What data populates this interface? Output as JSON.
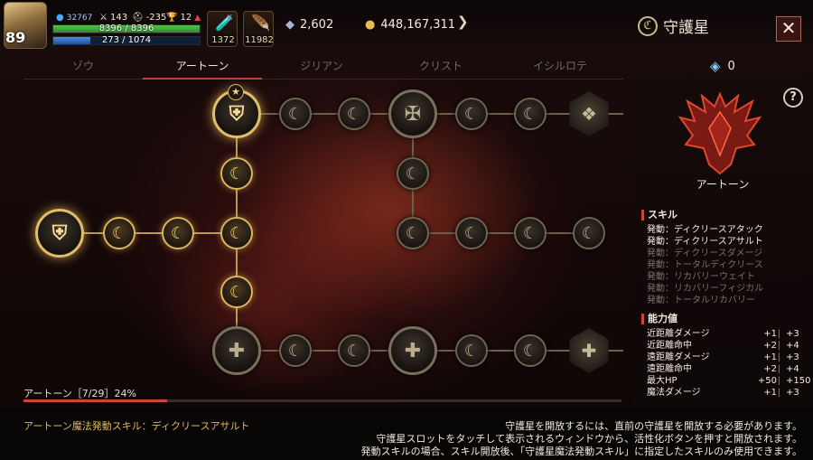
{
  "player": {
    "level": "89",
    "power": "32767",
    "attack": "143",
    "defense": "-235",
    "trophy": "12",
    "hp_text": "8396 / 8396",
    "mp_text": "273 / 1074",
    "mp_fraction": 0.254
  },
  "items": [
    {
      "icon": "potion-bag-icon",
      "glyph": "🧪",
      "count": "1372"
    },
    {
      "icon": "feather-potion-icon",
      "glyph": "🪶",
      "count": "11982"
    }
  ],
  "currency": {
    "crystal": "2,602",
    "gold": "448,167,311"
  },
  "header": {
    "title": "守護星",
    "close_label": "✕"
  },
  "tabs": [
    {
      "label": "ゾウ",
      "active": false
    },
    {
      "label": "アートーン",
      "active": true
    },
    {
      "label": "ジリアン",
      "active": false
    },
    {
      "label": "クリスト",
      "active": false
    },
    {
      "label": "イシルロテ",
      "active": false
    }
  ],
  "gem_count": "0",
  "tree": {
    "selected_badge": "★",
    "progress_text": "アートーン［7/29］24%",
    "progress_fraction": 0.24
  },
  "panel": {
    "help_label": "?",
    "emblem_label": "アートーン",
    "skill_title": "スキル",
    "skills": [
      {
        "text": "発動：ディクリースアタック",
        "active": true
      },
      {
        "text": "発動：ディクリースアサルト",
        "active": true
      },
      {
        "text": "発動：ディクリースダメージ",
        "active": false
      },
      {
        "text": "発動：トータルディクリース",
        "active": false
      },
      {
        "text": "発動：リカバリーウェイト",
        "active": false
      },
      {
        "text": "発動：リカバリーフィジカル",
        "active": false
      },
      {
        "text": "発動：トータルリカバリー",
        "active": false
      }
    ],
    "stat_title": "能力値",
    "stats": [
      {
        "name": "近距離ダメージ",
        "current": "+1",
        "max": "+3"
      },
      {
        "name": "近距離命中",
        "current": "+2",
        "max": "+4"
      },
      {
        "name": "遠距離ダメージ",
        "current": "+1",
        "max": "+3"
      },
      {
        "name": "遠距離命中",
        "current": "+2",
        "max": "+4"
      },
      {
        "name": "最大HP",
        "current": "+50",
        "max": "+150"
      },
      {
        "name": "魔法ダメージ",
        "current": "+1",
        "max": "+3"
      }
    ]
  },
  "footer": {
    "active_skill": "アートーン魔法発動スキル：ディクリースアサルト",
    "notes": [
      "守護星を開放するには、直前の守護星を開放する必要があります。",
      "守護星スロットをタッチして表示されるウィンドウから、活性化ボタンを押すと開放されます。",
      "発動スキルの場合、スキル開放後、「守護星魔法発動スキル」に指定したスキルのみ使用できます。"
    ]
  },
  "colors": {
    "accent_gold": "#d8b45a",
    "accent_red": "#c9463a",
    "hp_green": "#57c44f",
    "mp_blue": "#4d8de0"
  }
}
